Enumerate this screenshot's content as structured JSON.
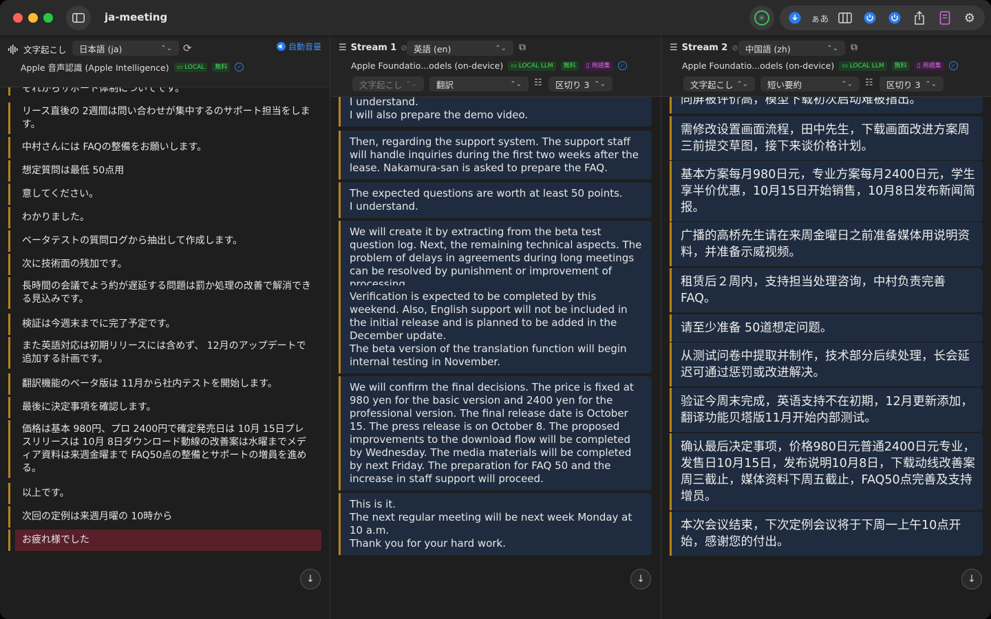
{
  "app": {
    "title": "ja-meeting"
  },
  "toolbar": {
    "kana_label": "ぁあ"
  },
  "pane1": {
    "label": "文字起こし",
    "language": "日本語 (ja)",
    "model": "Apple 音声認識 (Apple Intelligence)",
    "badge_local": "LOCAL",
    "badge_free": "無料",
    "auto_volume": "自動音量",
    "items": [
      "それからサポート体制についてです。",
      "リース直後の 2週間は問い合わせが集中するのサポート担当をします。",
      "中村さんには FAQの整備をお願いします。",
      "想定質問は最低 50点用",
      "意してください。",
      "わかりました。",
      "ベータテストの質問ログから抽出して作成します。",
      "次に技術面の残加です。",
      "長時間の会議でよう約が遅延する問題は罰か処理の改善で解消できる見込みです。",
      "検証は今週末までに完了予定です。",
      "また英語対応は初期リリースには含めず、 12月のアップデートで追加する計画です。",
      "翻訳機能のベータ版は 11月から社内テストを開始します。",
      "最後に決定事項を確認します。",
      "価格は基本 980円、プロ 2400円で確定発売日は 10月 15日プレスリリースは 10月 8日ダウンロード動線の改善案は水曜までメディア資料は来週金曜まで FAQ50点の整備とサポートの増員を進める。",
      "以上です。",
      "次回の定例は来週月曜の 10時から",
      "お疲れ様でした"
    ]
  },
  "pane2": {
    "title": "Stream 1",
    "language": "英語 (en)",
    "model": "Apple Foundatio...odels (on-device)",
    "badge_local": "LOCAL LLM",
    "badge_free": "無料",
    "badge_gloss": "用語集",
    "source_select": "文字起こし",
    "mode_select": "翻訳",
    "chunk_select": "区切り 3",
    "items": [
      "I understand.\nI will also prepare the demo video.",
      "Then, regarding the support system. The support staff will handle inquiries during the first two weeks after the lease. Nakamura-san is asked to prepare the FAQ.",
      "The expected questions are worth at least 50 points.\nI understand.",
      "We will create it by extracting from the beta test question log. Next, the remaining technical aspects. The problem of delays in agreements during long meetings can be resolved by punishment or improvement of processing.",
      "Verification is expected to be completed by this weekend. Also, English support will not be included in the initial release and is planned to be added in the December update.\nThe beta version of the translation function will begin internal testing in November.",
      "We will confirm the final decisions. The price is fixed at 980 yen for the basic version and 2400 yen for the professional version. The final release date is October 15. The press release is on October 8. The proposed improvements to the download flow will be completed by Wednesday. The media materials will be completed by next Friday. The preparation for FAQ 50 and the increase in staff support will proceed.",
      "This is it.\nThe next regular meeting will be next week Monday at 10 a.m.\nThank you for your hard work."
    ]
  },
  "pane3": {
    "title": "Stream 2",
    "language": "中国語 (zh)",
    "model": "Apple Foundatio...odels (on-device)",
    "badge_local": "LOCAL LLM",
    "badge_free": "無料",
    "badge_gloss": "用語集",
    "source_select": "文字起こし",
    "mode_select": "短い要約",
    "chunk_select": "区切り 3",
    "items": [
      "同屏被评价高，模型下载初次启动难被指出。",
      "需修改设置画面流程，田中先生，下载画面改进方案周三前提交草图，接下来谈价格计划。",
      "基本方案每月980日元，专业方案每月2400日元，学生享半价优惠，10月15日开始销售，10月8日发布新闻简报。",
      "广播的高桥先生请在来周金曜日之前准备媒体用说明资料，并准备示威视频。",
      "租赁后２周内，支持担当处理咨询，中村负责完善FAQ。",
      "请至少准备 50道想定问题。",
      "从测试问卷中提取并制作，技术部分后续处理，长会延迟可通过惩罚或改进解决。",
      "验证今周末完成，英语支持不在初期，12月更新添加，翻译功能贝塔版11月开始内部测试。",
      "确认最后决定事项，价格980日元普通2400日元专业，发售日10月15日，发布说明10月8日，下载动线改善案周三截止，媒体资料下周五截止，FAQ50点完善及支持增员。",
      "本次会议结束，下次定例会议将于下周一上午10点开始，感谢您的付出。"
    ]
  }
}
